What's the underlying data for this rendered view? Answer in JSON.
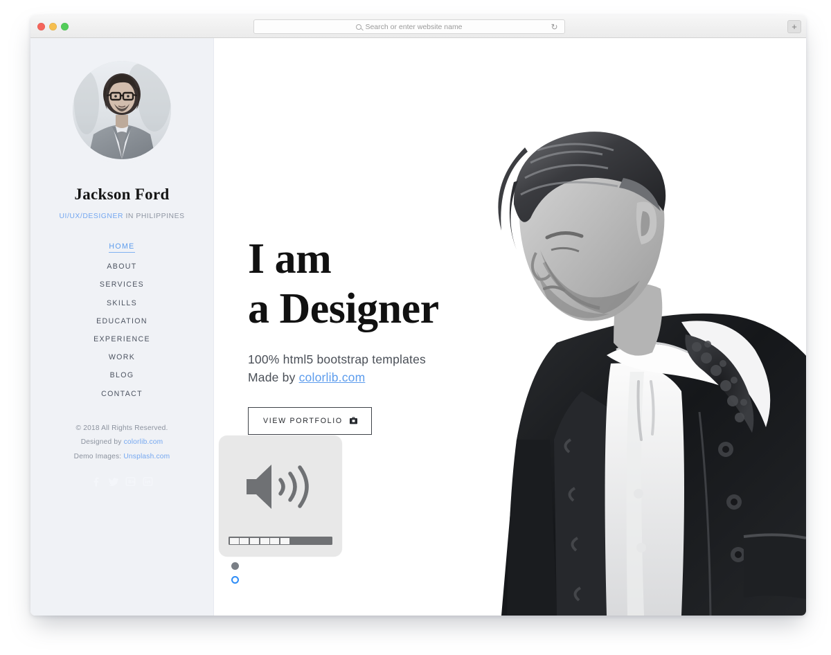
{
  "browser": {
    "search_placeholder": "Search or enter website name",
    "search_value": "",
    "reload_icon": "reload-icon",
    "new_tab_label": "+",
    "traffic_lights": [
      "close",
      "minimize",
      "maximize"
    ]
  },
  "sidebar": {
    "avatar_icon": "profile-avatar",
    "name": "Jackson Ford",
    "role_accent": "UI/UX/DESIGNER",
    "role_rest": " IN PHILIPPINES",
    "nav": [
      {
        "label": "HOME",
        "active": true
      },
      {
        "label": "ABOUT",
        "active": false
      },
      {
        "label": "SERVICES",
        "active": false
      },
      {
        "label": "SKILLS",
        "active": false
      },
      {
        "label": "EDUCATION",
        "active": false
      },
      {
        "label": "EXPERIENCE",
        "active": false
      },
      {
        "label": "WORK",
        "active": false
      },
      {
        "label": "BLOG",
        "active": false
      },
      {
        "label": "CONTACT",
        "active": false
      }
    ],
    "footer": {
      "copyright": "© 2018 All Rights Reserved.",
      "designed_by_label": "Designed by ",
      "designed_by_link": "colorlib.com",
      "demo_images_label": "Demo Images: ",
      "demo_images_link": "Unsplash.com"
    },
    "social": [
      {
        "name": "facebook-icon"
      },
      {
        "name": "twitter-icon"
      },
      {
        "name": "behance-icon"
      },
      {
        "name": "linkedin-icon"
      }
    ]
  },
  "hero": {
    "title_line1": "I am",
    "title_line2": "a Designer",
    "subtitle_line1": "100% html5 bootstrap templates",
    "subtitle_line2_prefix": "Made by ",
    "subtitle_line2_link": "colorlib.com",
    "button_label": "VIEW PORTFOLIO",
    "button_icon": "briefcase-icon",
    "photo_icon": "hero-portrait-photo"
  },
  "volume_osd": {
    "icon": "speaker-volume-icon",
    "segments_total": 10,
    "segments_filled": 6,
    "level_percent": 60
  },
  "carousel": {
    "dots": [
      {
        "state": "filled"
      },
      {
        "state": "ring"
      }
    ]
  },
  "colors": {
    "accent_blue": "#5c9ced",
    "sidebar_bg": "#f0f2f6",
    "text_dark": "#111111",
    "text_muted": "#8b929e",
    "osd_bg": "#e8e8e8",
    "osd_bar": "#6f7174",
    "dot_filled": "#7a7f86",
    "dot_ring": "#2d8cf6"
  }
}
